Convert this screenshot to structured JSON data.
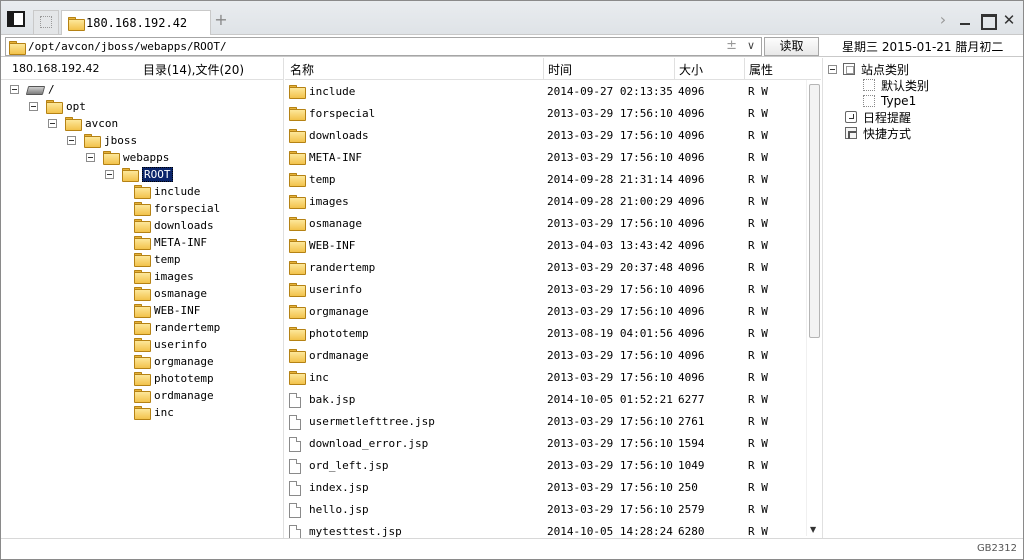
{
  "tab": {
    "title": "180.168.192.42"
  },
  "address": {
    "path": "/opt/avcon/jboss/webapps/ROOT/",
    "pm_symbol": "±",
    "dropdown_symbol": "∨"
  },
  "toolbar": {
    "read_label": "读取",
    "date_text": "星期三  2015-01-21  腊月初二"
  },
  "tree": {
    "host": "180.168.192.42",
    "count_label": "目录(14),文件(20)",
    "nodes": [
      {
        "label": "/",
        "depth": 0,
        "type": "drive"
      },
      {
        "label": "opt",
        "depth": 1,
        "type": "folder"
      },
      {
        "label": "avcon",
        "depth": 2,
        "type": "folder"
      },
      {
        "label": "jboss",
        "depth": 3,
        "type": "folder"
      },
      {
        "label": "webapps",
        "depth": 4,
        "type": "folder"
      },
      {
        "label": "ROOT",
        "depth": 5,
        "type": "folder",
        "selected": true
      },
      {
        "label": "include",
        "depth": 6,
        "type": "folder"
      },
      {
        "label": "forspecial",
        "depth": 6,
        "type": "folder"
      },
      {
        "label": "downloads",
        "depth": 6,
        "type": "folder"
      },
      {
        "label": "META-INF",
        "depth": 6,
        "type": "folder"
      },
      {
        "label": "temp",
        "depth": 6,
        "type": "folder"
      },
      {
        "label": "images",
        "depth": 6,
        "type": "folder"
      },
      {
        "label": "osmanage",
        "depth": 6,
        "type": "folder"
      },
      {
        "label": "WEB-INF",
        "depth": 6,
        "type": "folder"
      },
      {
        "label": "randertemp",
        "depth": 6,
        "type": "folder"
      },
      {
        "label": "userinfo",
        "depth": 6,
        "type": "folder"
      },
      {
        "label": "orgmanage",
        "depth": 6,
        "type": "folder"
      },
      {
        "label": "phototemp",
        "depth": 6,
        "type": "folder"
      },
      {
        "label": "ordmanage",
        "depth": 6,
        "type": "folder"
      },
      {
        "label": "inc",
        "depth": 6,
        "type": "folder"
      }
    ]
  },
  "list": {
    "columns": {
      "name": "名称",
      "time": "时间",
      "size": "大小",
      "attr": "属性"
    },
    "rows": [
      {
        "type": "folder",
        "name": "include",
        "time": "2014-09-27 02:13:35",
        "size": "4096",
        "attr": "R W"
      },
      {
        "type": "folder",
        "name": "forspecial",
        "time": "2013-03-29 17:56:10",
        "size": "4096",
        "attr": "R W"
      },
      {
        "type": "folder",
        "name": "downloads",
        "time": "2013-03-29 17:56:10",
        "size": "4096",
        "attr": "R W"
      },
      {
        "type": "folder",
        "name": "META-INF",
        "time": "2013-03-29 17:56:10",
        "size": "4096",
        "attr": "R W"
      },
      {
        "type": "folder",
        "name": "temp",
        "time": "2014-09-28 21:31:14",
        "size": "4096",
        "attr": "R W"
      },
      {
        "type": "folder",
        "name": "images",
        "time": "2014-09-28 21:00:29",
        "size": "4096",
        "attr": "R W"
      },
      {
        "type": "folder",
        "name": "osmanage",
        "time": "2013-03-29 17:56:10",
        "size": "4096",
        "attr": "R W"
      },
      {
        "type": "folder",
        "name": "WEB-INF",
        "time": "2013-04-03 13:43:42",
        "size": "4096",
        "attr": "R W"
      },
      {
        "type": "folder",
        "name": "randertemp",
        "time": "2013-03-29 20:37:48",
        "size": "4096",
        "attr": "R W"
      },
      {
        "type": "folder",
        "name": "userinfo",
        "time": "2013-03-29 17:56:10",
        "size": "4096",
        "attr": "R W"
      },
      {
        "type": "folder",
        "name": "orgmanage",
        "time": "2013-03-29 17:56:10",
        "size": "4096",
        "attr": "R W"
      },
      {
        "type": "folder",
        "name": "phototemp",
        "time": "2013-08-19 04:01:56",
        "size": "4096",
        "attr": "R W"
      },
      {
        "type": "folder",
        "name": "ordmanage",
        "time": "2013-03-29 17:56:10",
        "size": "4096",
        "attr": "R W"
      },
      {
        "type": "folder",
        "name": "inc",
        "time": "2013-03-29 17:56:10",
        "size": "4096",
        "attr": "R W"
      },
      {
        "type": "file",
        "name": "bak.jsp",
        "time": "2014-10-05 01:52:21",
        "size": "6277",
        "attr": "R W"
      },
      {
        "type": "file",
        "name": "usermetlefttree.jsp",
        "time": "2013-03-29 17:56:10",
        "size": "2761",
        "attr": "R W"
      },
      {
        "type": "file",
        "name": "download_error.jsp",
        "time": "2013-03-29 17:56:10",
        "size": "1594",
        "attr": "R W"
      },
      {
        "type": "file",
        "name": "ord_left.jsp",
        "time": "2013-03-29 17:56:10",
        "size": "1049",
        "attr": "R W"
      },
      {
        "type": "file",
        "name": "index.jsp",
        "time": "2013-03-29 17:56:10",
        "size": "250",
        "attr": "R W"
      },
      {
        "type": "file",
        "name": "hello.jsp",
        "time": "2013-03-29 17:56:10",
        "size": "2579",
        "attr": "R W"
      },
      {
        "type": "file",
        "name": "mytesttest.jsp",
        "time": "2014-10-05 14:28:24",
        "size": "6280",
        "attr": "R W"
      }
    ]
  },
  "right_panel": {
    "nodes": [
      {
        "label": "站点类别",
        "depth": 0,
        "icon": "category-icon",
        "expander": true
      },
      {
        "label": "默认类别",
        "depth": 1,
        "icon": "dotted-item-icon"
      },
      {
        "label": "Type1",
        "depth": 1,
        "icon": "dotted-item-icon"
      },
      {
        "label": "日程提醒",
        "depth": 0,
        "icon": "schedule-icon"
      },
      {
        "label": "快捷方式",
        "depth": 0,
        "icon": "shortcut-icon"
      }
    ]
  },
  "status": {
    "encoding": "GB2312"
  }
}
